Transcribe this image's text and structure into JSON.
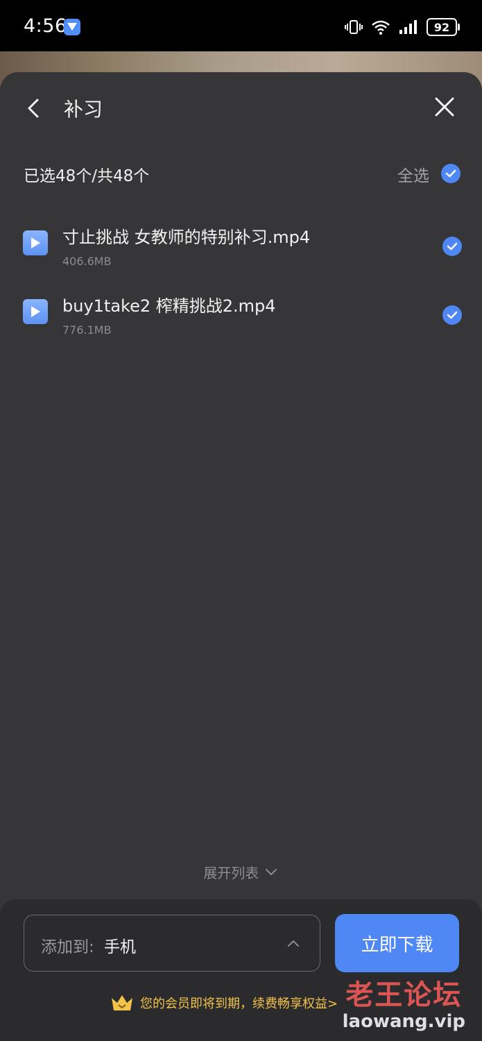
{
  "status_bar": {
    "time": "4:56",
    "battery": "92",
    "icons": [
      "app-notification-icon",
      "vibrate-icon",
      "wifi-icon",
      "signal-icon",
      "battery-icon"
    ]
  },
  "header": {
    "title": "补习",
    "back_icon": "chevron-left-icon",
    "close_icon": "close-icon"
  },
  "selection": {
    "count_text": "已选48个/共48个",
    "select_all_label": "全选",
    "select_all_checked": true
  },
  "files": [
    {
      "name": "寸止挑战 女教师的特别补习.mp4",
      "size": "406.6MB",
      "checked": true
    },
    {
      "name": "buy1take2 榨精挑战2.mp4",
      "size": "776.1MB",
      "checked": true
    }
  ],
  "expand_list": {
    "label": "展开列表"
  },
  "bottom": {
    "target_prefix": "添加到:",
    "target_value": "手机",
    "download_label": "立即下载",
    "vip_notice": "您的会员即将到期，续费畅享权益>"
  },
  "watermark": {
    "cn": "老王论坛",
    "en": "laowang.vip"
  },
  "colors": {
    "accent": "#4f87f5",
    "sheet_bg": "#363638",
    "panel_bg": "#2b2b2d",
    "vip_gold": "#f3c24a"
  }
}
